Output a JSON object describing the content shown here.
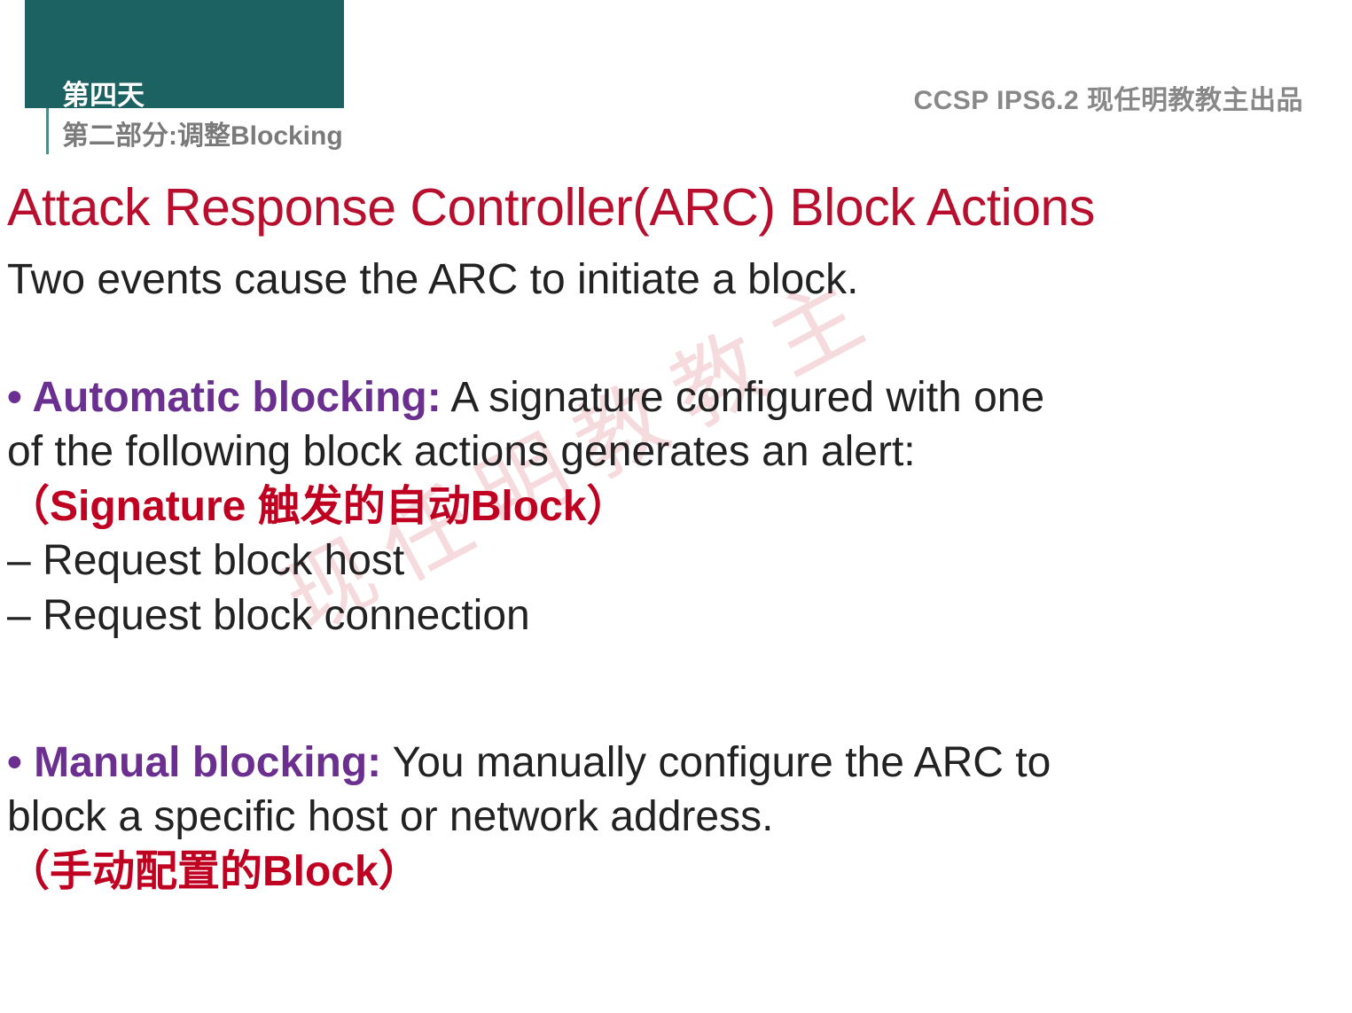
{
  "header": {
    "day": "第四天",
    "section": "第二部分:调整Blocking",
    "right": "CCSP IPS6.2  现任明教教主出品"
  },
  "title": "Attack Response Controller(ARC) Block Actions",
  "intro": "Two events cause the ARC to initiate a block.",
  "auto": {
    "bullet": "• Automatic blocking:",
    "desc1": " A signature configured with one",
    "desc2": "of the following block actions generates an alert:",
    "note": "（Signature 触发的自动Block）",
    "item1": "– Request block host",
    "item2": "– Request block connection"
  },
  "manual": {
    "bullet": "• Manual blocking:",
    "desc1": " You manually configure the ARC to",
    "desc2": "block a specific host or network address.",
    "note": "（手动配置的Block）"
  },
  "watermark": "现任明教教主"
}
